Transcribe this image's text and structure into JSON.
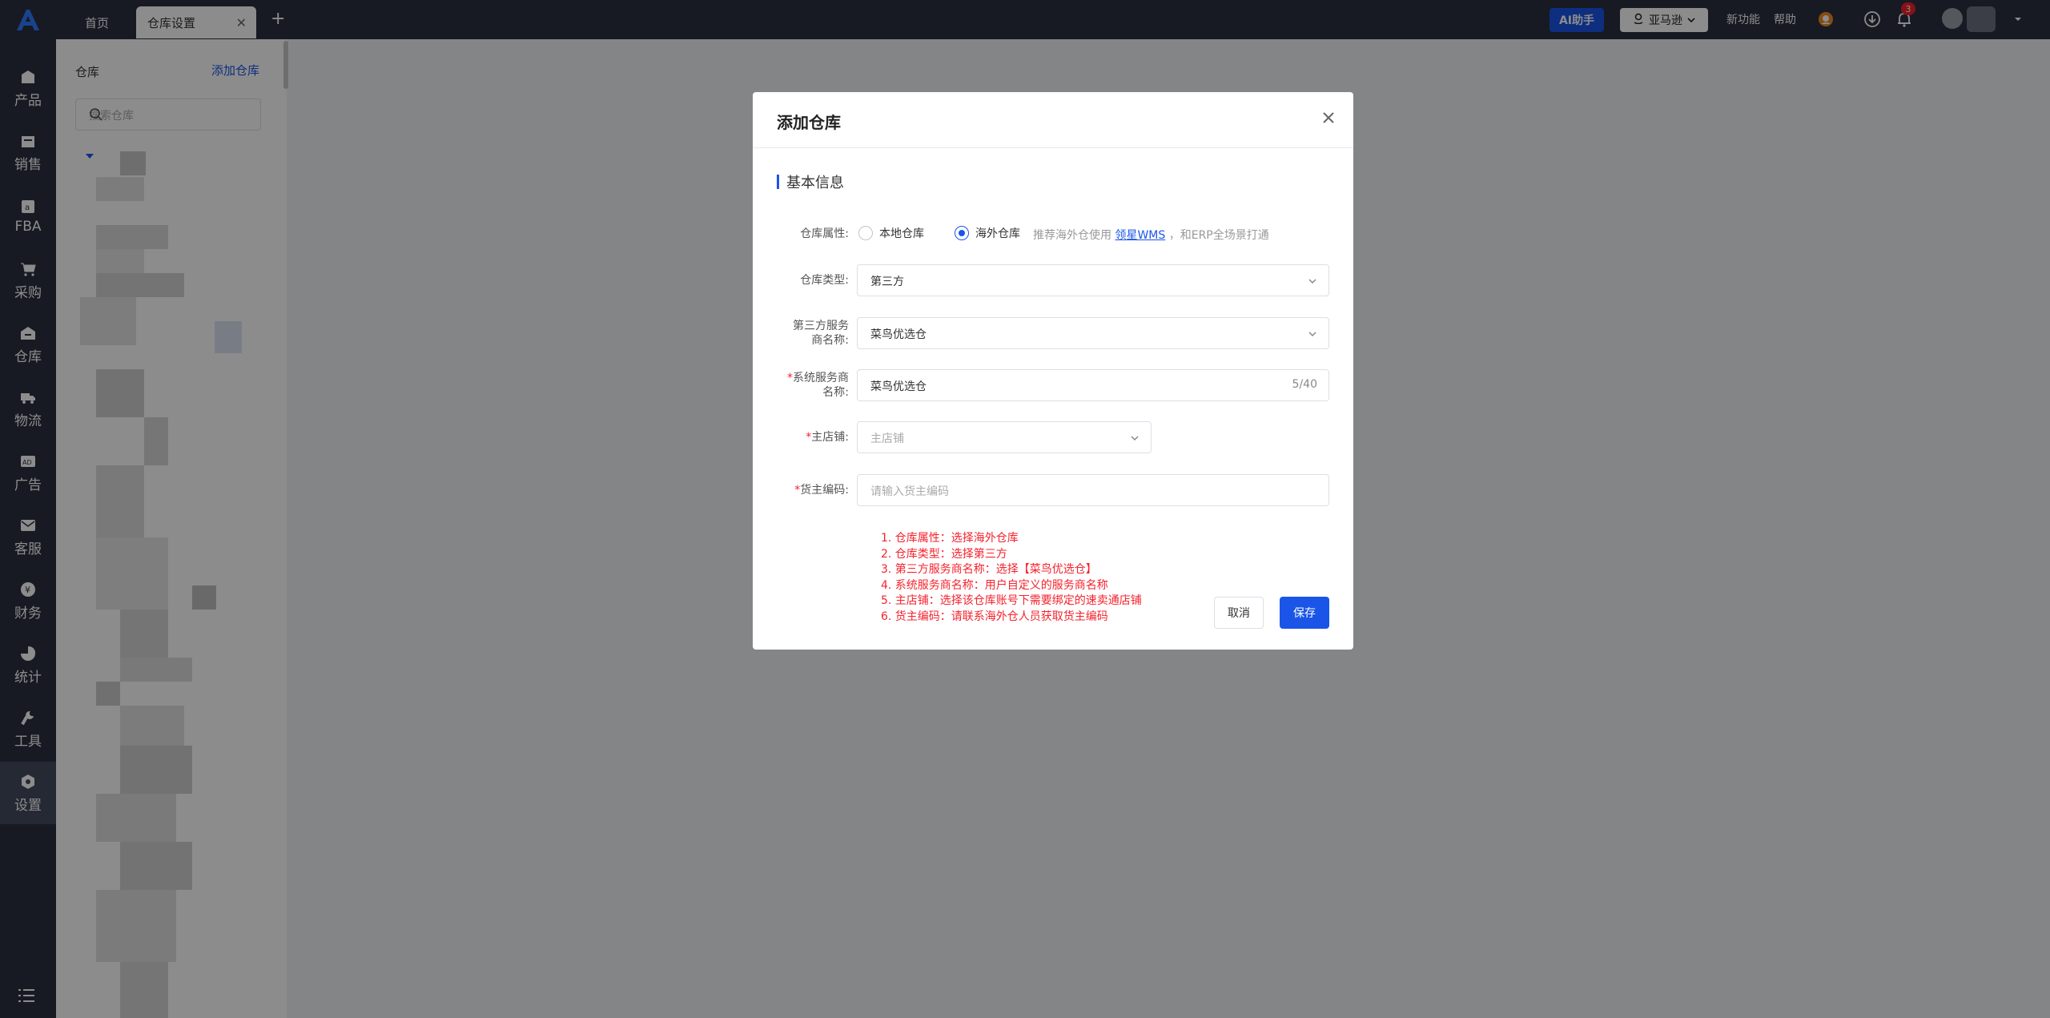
{
  "topbar": {
    "tabs": [
      {
        "label": "首页"
      },
      {
        "label": "仓库设置"
      }
    ],
    "ai_button": "AI助手",
    "marketplace": "亚马逊",
    "new_features": "新功能",
    "help": "帮助",
    "notification_count": "3"
  },
  "nav": {
    "items": [
      {
        "label": "产品"
      },
      {
        "label": "销售"
      },
      {
        "label": "FBA"
      },
      {
        "label": "采购"
      },
      {
        "label": "仓库"
      },
      {
        "label": "物流"
      },
      {
        "label": "广告"
      },
      {
        "label": "客服"
      },
      {
        "label": "财务"
      },
      {
        "label": "统计"
      },
      {
        "label": "工具"
      },
      {
        "label": "设置"
      }
    ],
    "active": "设置"
  },
  "panel": {
    "title": "仓库",
    "add_link": "添加仓库",
    "search_placeholder": "搜索仓库"
  },
  "modal": {
    "title": "添加仓库",
    "section": "基本信息",
    "warehouse_attr": {
      "label": "仓库属性:",
      "options": [
        "本地仓库",
        "海外仓库"
      ],
      "selected": "海外仓库",
      "hint_prefix": "推荐海外仓使用",
      "hint_link": "领星WMS",
      "hint_suffix": "，和ERP全场景打通"
    },
    "warehouse_type": {
      "label": "仓库类型:",
      "value": "第三方"
    },
    "provider_name": {
      "label_line1": "第三方服务",
      "label_line2": "商名称:",
      "value": "菜鸟优选仓"
    },
    "system_provider_name": {
      "label_line1": "系统服务商",
      "label_line2": "名称:",
      "value": "菜鸟优选仓",
      "count": "5/40"
    },
    "main_store": {
      "label": "主店铺:",
      "placeholder": "主店铺"
    },
    "owner_code": {
      "label": "货主编码:",
      "placeholder": "请输入货主编码"
    },
    "notes": [
      "1. 仓库属性：选择海外仓库",
      "2. 仓库类型：选择第三方",
      "3. 第三方服务商名称：选择【菜鸟优选仓】",
      "4. 系统服务商名称：用户自定义的服务商名称",
      "5. 主店铺：选择该仓库账号下需要绑定的速卖通店铺",
      "6. 货主编码：请联系海外仓人员获取货主编码"
    ],
    "cancel": "取消",
    "save": "保存"
  },
  "colors": {
    "accent": "#1a55e8",
    "dark": "#2b3140",
    "error": "#f5222d"
  }
}
